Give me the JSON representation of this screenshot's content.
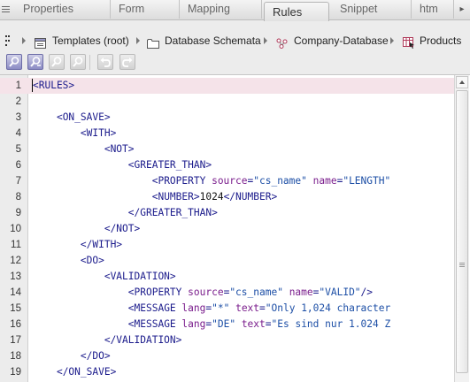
{
  "tabs": [
    {
      "label": "Properties"
    },
    {
      "label": "Form"
    },
    {
      "label": "Mapping"
    },
    {
      "label": "Rules"
    },
    {
      "label": "Snippet"
    },
    {
      "label": "htm"
    }
  ],
  "breadcrumb": {
    "items": [
      {
        "label": "Templates (root)",
        "icon": "templates-icon"
      },
      {
        "label": "Database Schemata",
        "icon": "folder-icon"
      },
      {
        "label": "Company-Database",
        "icon": "database-schema-icon"
      },
      {
        "label": "Products",
        "icon": "table-icon"
      }
    ]
  },
  "toolbar": {
    "buttons": [
      {
        "name": "search-button",
        "icon": "magnifier-icon",
        "state": "active"
      },
      {
        "name": "search-replace-button",
        "icon": "magnifier-replace-icon",
        "state": "active"
      },
      {
        "name": "find-next-button",
        "icon": "magnifier-icon",
        "state": "disabled"
      },
      {
        "name": "find-previous-button",
        "icon": "magnifier-icon",
        "state": "disabled"
      },
      {
        "name": "undo-button",
        "icon": "undo-icon",
        "state": "disabled"
      },
      {
        "name": "redo-button",
        "icon": "redo-icon",
        "state": "disabled"
      }
    ]
  },
  "editor": {
    "current_line": 1,
    "lines": [
      {
        "n": "1",
        "tokens": [
          [
            "tag",
            "<RULES>"
          ]
        ]
      },
      {
        "n": "2",
        "tokens": []
      },
      {
        "n": "3",
        "tokens": [
          [
            "text",
            "    "
          ],
          [
            "tag",
            "<ON_SAVE>"
          ]
        ]
      },
      {
        "n": "4",
        "tokens": [
          [
            "text",
            "        "
          ],
          [
            "tag",
            "<WITH>"
          ]
        ]
      },
      {
        "n": "5",
        "tokens": [
          [
            "text",
            "            "
          ],
          [
            "tag",
            "<NOT>"
          ]
        ]
      },
      {
        "n": "6",
        "tokens": [
          [
            "text",
            "                "
          ],
          [
            "tag",
            "<GREATER_THAN>"
          ]
        ]
      },
      {
        "n": "7",
        "tokens": [
          [
            "text",
            "                    "
          ],
          [
            "tag",
            "<PROPERTY "
          ],
          [
            "attr",
            "source"
          ],
          [
            "tag",
            "="
          ],
          [
            "str",
            "\"cs_name\""
          ],
          [
            "text",
            " "
          ],
          [
            "attr",
            "name"
          ],
          [
            "tag",
            "="
          ],
          [
            "str",
            "\"LENGTH\""
          ]
        ]
      },
      {
        "n": "8",
        "tokens": [
          [
            "text",
            "                    "
          ],
          [
            "tag",
            "<NUMBER>"
          ],
          [
            "text",
            "1024"
          ],
          [
            "tag",
            "</NUMBER>"
          ]
        ]
      },
      {
        "n": "9",
        "tokens": [
          [
            "text",
            "                "
          ],
          [
            "tag",
            "</GREATER_THAN>"
          ]
        ]
      },
      {
        "n": "10",
        "tokens": [
          [
            "text",
            "            "
          ],
          [
            "tag",
            "</NOT>"
          ]
        ]
      },
      {
        "n": "11",
        "tokens": [
          [
            "text",
            "        "
          ],
          [
            "tag",
            "</WITH>"
          ]
        ]
      },
      {
        "n": "12",
        "tokens": [
          [
            "text",
            "        "
          ],
          [
            "tag",
            "<DO>"
          ]
        ]
      },
      {
        "n": "13",
        "tokens": [
          [
            "text",
            "            "
          ],
          [
            "tag",
            "<VALIDATION>"
          ]
        ]
      },
      {
        "n": "14",
        "tokens": [
          [
            "text",
            "                "
          ],
          [
            "tag",
            "<PROPERTY "
          ],
          [
            "attr",
            "source"
          ],
          [
            "tag",
            "="
          ],
          [
            "str",
            "\"cs_name\""
          ],
          [
            "text",
            " "
          ],
          [
            "attr",
            "name"
          ],
          [
            "tag",
            "="
          ],
          [
            "str",
            "\"VALID\""
          ],
          [
            "tag",
            "/>"
          ]
        ]
      },
      {
        "n": "15",
        "tokens": [
          [
            "text",
            "                "
          ],
          [
            "tag",
            "<MESSAGE "
          ],
          [
            "attr",
            "lang"
          ],
          [
            "tag",
            "="
          ],
          [
            "str",
            "\"*\""
          ],
          [
            "text",
            " "
          ],
          [
            "attr",
            "text"
          ],
          [
            "tag",
            "="
          ],
          [
            "str",
            "\"Only 1,024 character"
          ]
        ]
      },
      {
        "n": "16",
        "tokens": [
          [
            "text",
            "                "
          ],
          [
            "tag",
            "<MESSAGE "
          ],
          [
            "attr",
            "lang"
          ],
          [
            "tag",
            "="
          ],
          [
            "str",
            "\"DE\""
          ],
          [
            "text",
            " "
          ],
          [
            "attr",
            "text"
          ],
          [
            "tag",
            "="
          ],
          [
            "str",
            "\"Es sind nur 1.024 Z"
          ]
        ]
      },
      {
        "n": "17",
        "tokens": [
          [
            "text",
            "            "
          ],
          [
            "tag",
            "</VALIDATION>"
          ]
        ]
      },
      {
        "n": "18",
        "tokens": [
          [
            "text",
            "        "
          ],
          [
            "tag",
            "</DO>"
          ]
        ]
      },
      {
        "n": "19",
        "tokens": [
          [
            "text",
            "    "
          ],
          [
            "tag",
            "</ON_SAVE>"
          ]
        ]
      }
    ]
  }
}
